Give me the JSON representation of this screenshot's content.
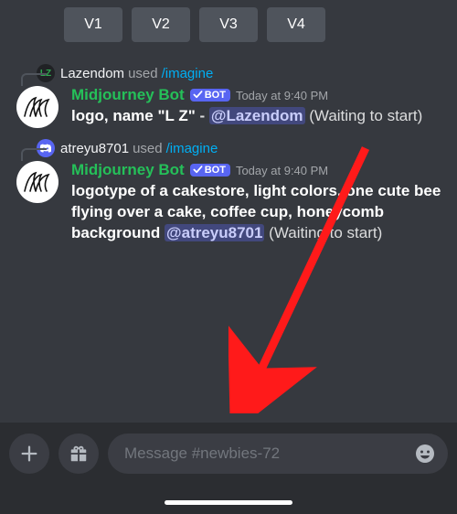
{
  "buttons": {
    "v1": "V1",
    "v2": "V2",
    "v3": "V3",
    "v4": "V4"
  },
  "msg1": {
    "reply_user": "Lazendom",
    "reply_used": "used",
    "reply_cmd": "/imagine",
    "bot_name": "Midjourney Bot",
    "bot_tag": "BOT",
    "timestamp": "Today at 9:40 PM",
    "prompt": "logo, name \"L Z\"",
    "sep": " - ",
    "mention": "@Lazendom",
    "waiting": " (Waiting to start)"
  },
  "msg2": {
    "reply_user": "atreyu8701",
    "reply_used": "used",
    "reply_cmd": "/imagine",
    "bot_name": "Midjourney Bot",
    "bot_tag": "BOT",
    "timestamp": "Today at 9:40 PM",
    "prompt": "logotype of a cakestore, light colors, one cute bee flying over a cake, coffee cup, honeycomb background",
    "sep": " ",
    "mention": "@atreyu8701",
    "waiting": " (Waiting to start)"
  },
  "composer": {
    "placeholder": "Message #newbies-72"
  }
}
